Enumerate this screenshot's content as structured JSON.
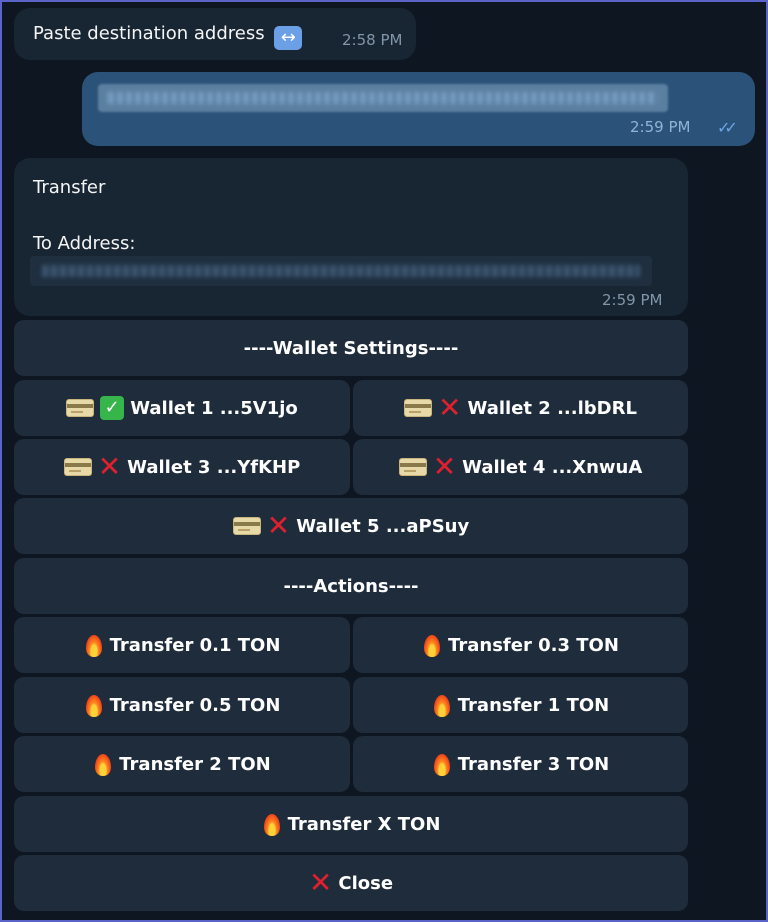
{
  "messages": {
    "m1": {
      "text": "Paste destination address",
      "time": "2:58 PM",
      "icon": "left-right-arrow-icon"
    },
    "m2": {
      "time": "2:59 PM",
      "status": "read",
      "content": "blurred-address"
    },
    "m3": {
      "title": "Transfer",
      "to_label": "To Address:",
      "time": "2:59 PM",
      "content": "blurred-address"
    }
  },
  "keyboard": {
    "wallet_header": "----Wallet Settings----",
    "wallets": [
      {
        "label": "Wallet 1 ...5V1jo",
        "selected": true
      },
      {
        "label": "Wallet 2 ...lbDRL",
        "selected": false
      },
      {
        "label": "Wallet 3 ...YfKHP",
        "selected": false
      },
      {
        "label": "Wallet 4 ...XnwuA",
        "selected": false
      },
      {
        "label": "Wallet 5 ...aPSuy",
        "selected": false
      }
    ],
    "actions_header": "----Actions----",
    "actions": [
      "Transfer 0.1 TON",
      "Transfer 0.3 TON",
      "Transfer 0.5 TON",
      "Transfer 1 TON",
      "Transfer 2 TON",
      "Transfer 3 TON",
      "Transfer X TON"
    ],
    "close": "Close"
  },
  "colors": {
    "background": "#0e1621",
    "incoming_bubble": "#182533",
    "outgoing_bubble": "#2b5278",
    "button": "#1f2c3b"
  }
}
